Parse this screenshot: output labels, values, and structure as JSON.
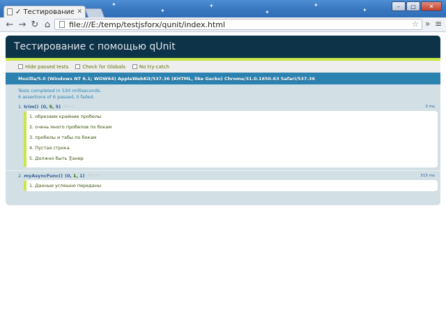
{
  "browser": {
    "tab_title": "✓ Тестирование с помощ",
    "url": "file:///E:/temp/testjsforx/qunit/index.html"
  },
  "qunit": {
    "header": "Тестирование с помощью qUnit",
    "toolbar": {
      "hide_passed": "Hide passed tests",
      "check_globals": "Check for Globals",
      "no_try_catch": "No try-catch"
    },
    "user_agent": "Mozilla/5.0 (Windows NT 6.1; WOW64) AppleWebKit/537.36 (KHTML, like Gecko) Chrome/31.0.1650.63 Safari/537.36",
    "result_line1": "Tests completed in 530 milliseconds.",
    "result_line2": "6 assertions of 6 passed, 0 failed.",
    "tests": [
      {
        "num": "1.",
        "name": "trim()",
        "counts_open": "(0,",
        "passed": "5,",
        "total": "5)",
        "rerun": "Rerun",
        "runtime": "0 ms",
        "assertions": [
          "1. обрезаем крайние пробелы",
          "2. очень много пробелов по бокам",
          "3. пробелы и табы по бокам",
          "4. Пустая строка",
          "5. Должно быть ][анер"
        ]
      },
      {
        "num": "2.",
        "name": "myAsyncFunc()",
        "counts_open": "(0,",
        "passed": "1,",
        "total": "1)",
        "rerun": "Rerun",
        "runtime": "515 ms",
        "assertions": [
          "1. Данные успешно переданы"
        ]
      }
    ]
  }
}
